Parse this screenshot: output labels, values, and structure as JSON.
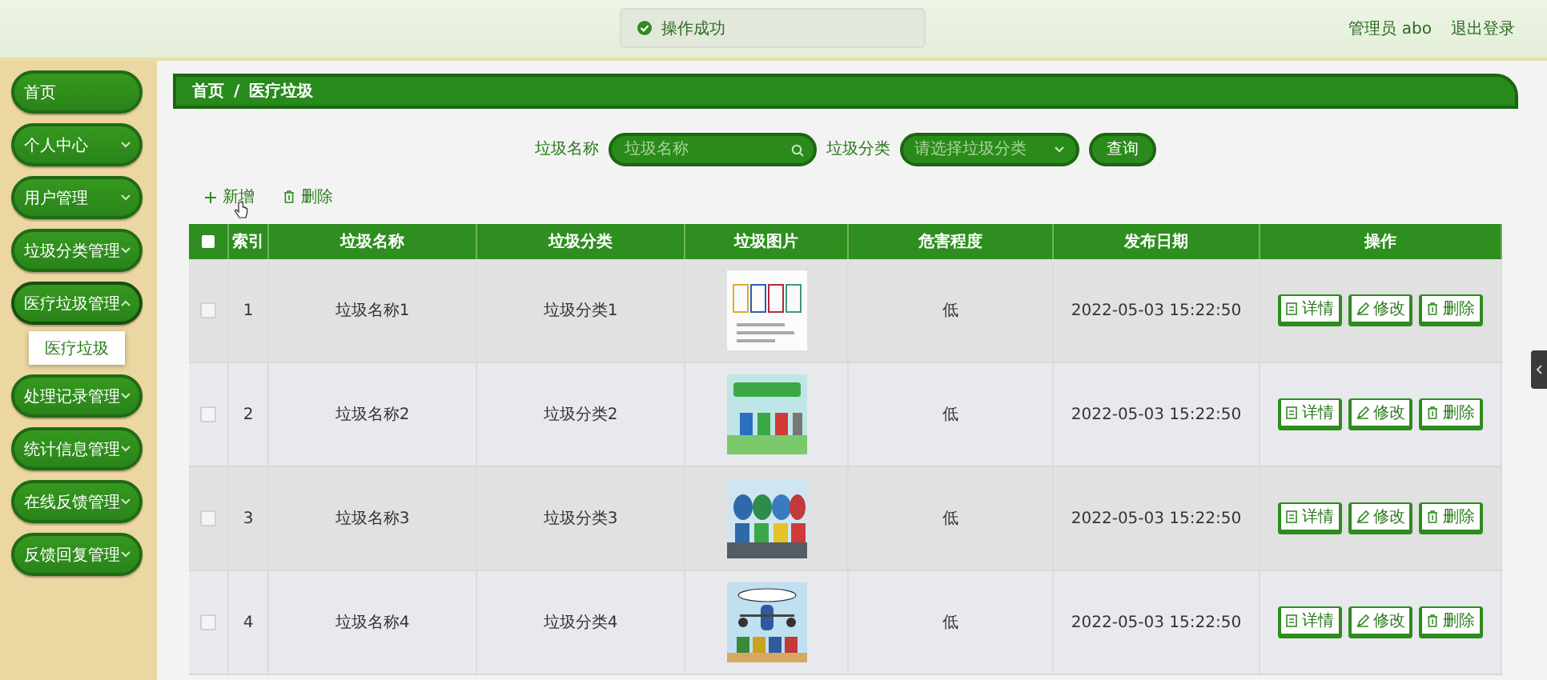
{
  "topbar": {
    "toast": "操作成功",
    "user": "管理员 abo",
    "logout": "退出登录"
  },
  "sidebar": {
    "items": [
      {
        "kind": "link",
        "label": "首页"
      },
      {
        "kind": "menu",
        "label": "个人中心",
        "expanded": false
      },
      {
        "kind": "menu",
        "label": "用户管理",
        "expanded": false
      },
      {
        "kind": "menu",
        "label": "垃圾分类管理",
        "expanded": false
      },
      {
        "kind": "menu",
        "label": "医疗垃圾管理",
        "expanded": true,
        "children": [
          {
            "label": "医疗垃圾"
          }
        ]
      },
      {
        "kind": "menu",
        "label": "处理记录管理",
        "expanded": false
      },
      {
        "kind": "menu",
        "label": "统计信息管理",
        "expanded": false
      },
      {
        "kind": "menu",
        "label": "在线反馈管理",
        "expanded": false
      },
      {
        "kind": "menu",
        "label": "反馈回复管理",
        "expanded": false
      }
    ]
  },
  "breadcrumb": {
    "items": [
      "首页",
      "医疗垃圾"
    ],
    "separator": "/"
  },
  "search": {
    "fields": [
      {
        "kind": "text",
        "label": "垃圾名称",
        "placeholder": "垃圾名称"
      },
      {
        "kind": "select",
        "label": "垃圾分类",
        "placeholder": "请选择垃圾分类"
      }
    ],
    "button": "查询"
  },
  "toolbar": [
    {
      "kind": "add",
      "label": "新增"
    },
    {
      "kind": "delete",
      "label": "删除"
    }
  ],
  "table": {
    "all_checked": false,
    "columns": [
      "索引",
      "垃圾名称",
      "垃圾分类",
      "垃圾图片",
      "危害程度",
      "发布日期",
      "操作"
    ],
    "rows": [
      {
        "checked": false,
        "index": "1",
        "name": "垃圾名称1",
        "category": "垃圾分类1",
        "danger": "低",
        "date": "2022-05-03 15:22:50",
        "actions": [
          {
            "kind": "detail",
            "label": "详情"
          },
          {
            "kind": "edit",
            "label": "修改"
          },
          {
            "kind": "delete",
            "label": "删除"
          }
        ]
      },
      {
        "checked": false,
        "index": "2",
        "name": "垃圾名称2",
        "category": "垃圾分类2",
        "danger": "低",
        "date": "2022-05-03 15:22:50",
        "actions": [
          {
            "kind": "detail",
            "label": "详情"
          },
          {
            "kind": "edit",
            "label": "修改"
          },
          {
            "kind": "delete",
            "label": "删除"
          }
        ]
      },
      {
        "checked": false,
        "index": "3",
        "name": "垃圾名称3",
        "category": "垃圾分类3",
        "danger": "低",
        "date": "2022-05-03 15:22:50",
        "actions": [
          {
            "kind": "detail",
            "label": "详情"
          },
          {
            "kind": "edit",
            "label": "修改"
          },
          {
            "kind": "delete",
            "label": "删除"
          }
        ]
      },
      {
        "checked": false,
        "index": "4",
        "name": "垃圾名称4",
        "category": "垃圾分类4",
        "danger": "低",
        "date": "2022-05-03 15:22:50",
        "actions": [
          {
            "kind": "detail",
            "label": "详情"
          },
          {
            "kind": "edit",
            "label": "修改"
          },
          {
            "kind": "delete",
            "label": "删除"
          }
        ]
      }
    ]
  }
}
